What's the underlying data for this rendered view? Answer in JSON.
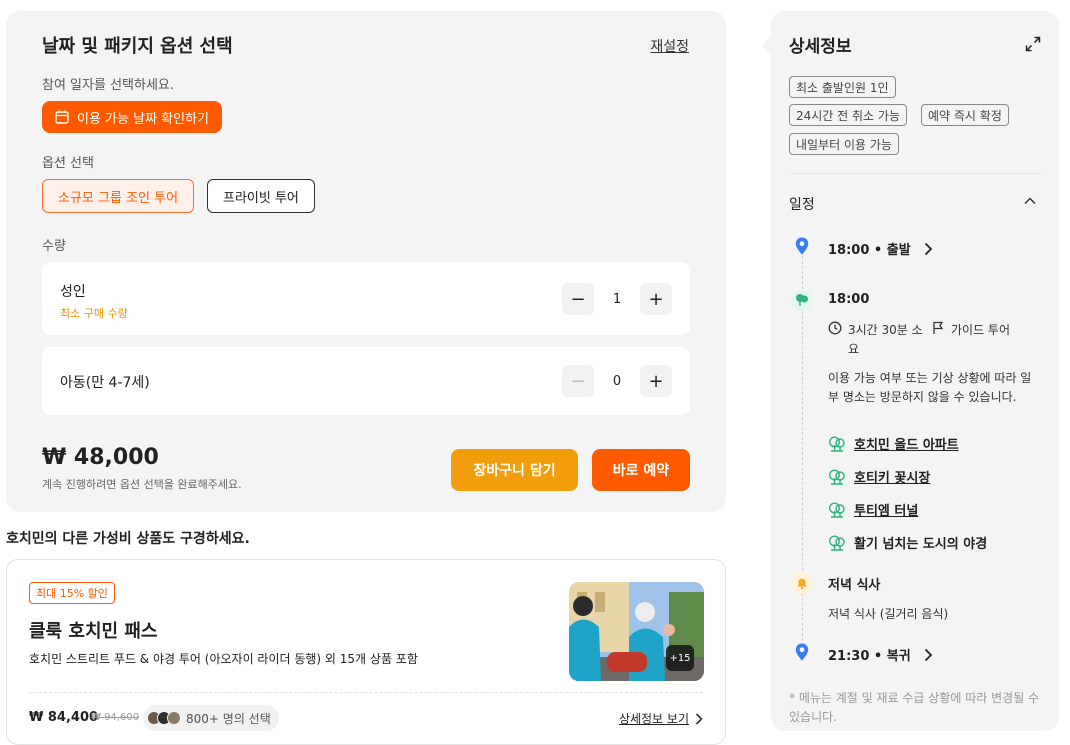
{
  "booking": {
    "title": "날짜 및 패키지 옵션 선택",
    "reset": "재설정",
    "date_hint": "참여 일자를 선택하세요.",
    "date_button": "이용 가능 날짜 확인하기",
    "options_label": "옵션 선택",
    "options": [
      {
        "label": "소규모 그룹 조인 투어",
        "selected": true
      },
      {
        "label": "프라이빗 투어",
        "selected": false
      }
    ],
    "quantity_label": "수량",
    "adult": {
      "name": "성인",
      "sub": "최소 구매 수량",
      "value": "1",
      "minus": "−",
      "plus": "+"
    },
    "child": {
      "name": "아동(만 4-7세)",
      "value": "0",
      "minus": "−",
      "plus": "+"
    },
    "price": "₩ 48,000",
    "price_note": "계속 진행하려면 옵션 선택을 완료해주세요.",
    "cart_button": "장바구니 담기",
    "book_button": "바로 예약"
  },
  "related": {
    "title": "호치민의 다른 가성비 상품도 구경하세요.",
    "badge": "최대 15% 할인",
    "pass_title": "클룩 호치민 패스",
    "pass_desc": "호치민 스트리트 푸드 & 야경 투어 (아오자이 라이더 동행) 외 15개 상품 포함",
    "thumb_count": "+15",
    "price": "₩ 84,400",
    "old_price": "₩ 94,600",
    "popularity": "800+ 명의 선택",
    "detail_link": "상세정보 보기"
  },
  "detail": {
    "title": "상세정보",
    "tags": [
      "최소 출발인원 1인",
      "24시간 전 취소 가능",
      "예약 즉시 확정",
      "내일부터 이용 가능"
    ],
    "schedule_title": "일정",
    "depart_time": "18:00",
    "depart_label": "출발",
    "activity_time": "18:00",
    "duration": "3시간 30분 소요",
    "guide": "가이드 투어",
    "notice": "이용 가능 여부 또는 기상 상황에 따라 일부 명소는 방문하지 않을 수 있습니다.",
    "spots": [
      "호치민 올드 아파트",
      "호티키 꽃시장",
      "투티엠 터널",
      "활기 넘치는 도시의 야경"
    ],
    "dinner_title": "저녁 식사",
    "dinner_desc": "저녁 식사 (길거리 음식)",
    "return_time": "21:30",
    "return_label": "복귀",
    "footnote": "* 메뉴는 계절 및 재료 수급 상황에 따라 변경될 수 있습니다."
  },
  "colors": {
    "accent": "#ff5a00",
    "cart": "#f29d0b",
    "panel_bg": "#f4f4f4",
    "pin_blue": "#3b7cf0",
    "spot_green": "#2db37d",
    "bell_orange": "#f5a623"
  }
}
